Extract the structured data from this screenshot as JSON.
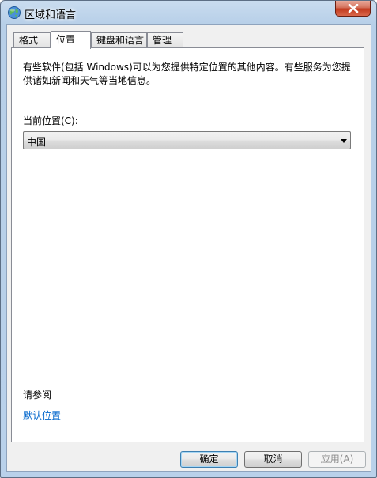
{
  "window": {
    "title": "区域和语言"
  },
  "tabs": [
    {
      "label": "格式",
      "active": false
    },
    {
      "label": "位置",
      "active": true
    },
    {
      "label": "键盘和语言",
      "active": false
    },
    {
      "label": "管理",
      "active": false
    }
  ],
  "location_tab": {
    "description": "有些软件(包括 Windows)可以为您提供特定位置的其他内容。有些服务为您提供诸如新闻和天气等当地信息。",
    "current_location_label": "当前位置(C):",
    "current_location_value": "中国",
    "see_also_label": "请参阅",
    "default_location_link": "默认位置"
  },
  "buttons": {
    "ok": "确定",
    "cancel": "取消",
    "apply": "应用(A)"
  },
  "icons": {
    "title": "globe-icon",
    "close": "close-icon",
    "dropdown": "chevron-down-icon"
  },
  "colors": {
    "link": "#0066cc",
    "close_button": "#c23a1f"
  }
}
